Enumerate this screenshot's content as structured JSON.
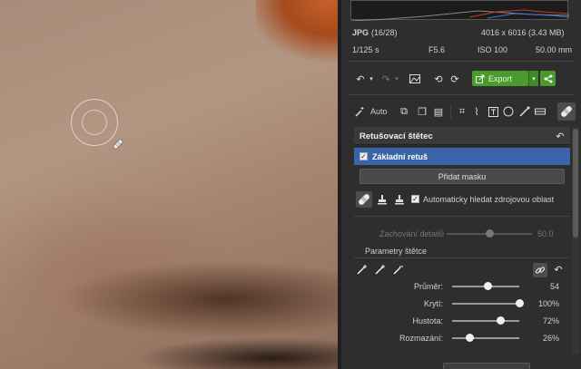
{
  "file_info": {
    "format": "JPG",
    "index": "(16/28)",
    "dimensions": "4016 x 6016 (3.43 MB)",
    "shutter": "1/125 s",
    "aperture": "F5.6",
    "iso": "ISO 100",
    "focal": "50.00 mm"
  },
  "toolbar": {
    "export_label": "Export",
    "auto_label": "Auto"
  },
  "tool_panel": {
    "title": "Retušovací štětec",
    "basic_retouch_label": "Základní retuš",
    "add_mask_label": "Přidat masku",
    "auto_source_label": "Automaticky hledat zdrojovou oblast",
    "detail_label": "Zachování detailů",
    "detail_value": "50.0",
    "detail_level": 0.5,
    "brush_params_title": "Parametry štětce",
    "params": [
      {
        "label": "Průměr:",
        "value": "54",
        "level": 0.54
      },
      {
        "label": "Krytí:",
        "value": "100%",
        "level": 1.0
      },
      {
        "label": "Hustota:",
        "value": "72%",
        "level": 0.72
      },
      {
        "label": "Rozmazání:",
        "value": "26%",
        "level": 0.26
      }
    ]
  },
  "colors": {
    "accent_green": "#4a9a2e",
    "selection_blue": "#3a64a8"
  }
}
